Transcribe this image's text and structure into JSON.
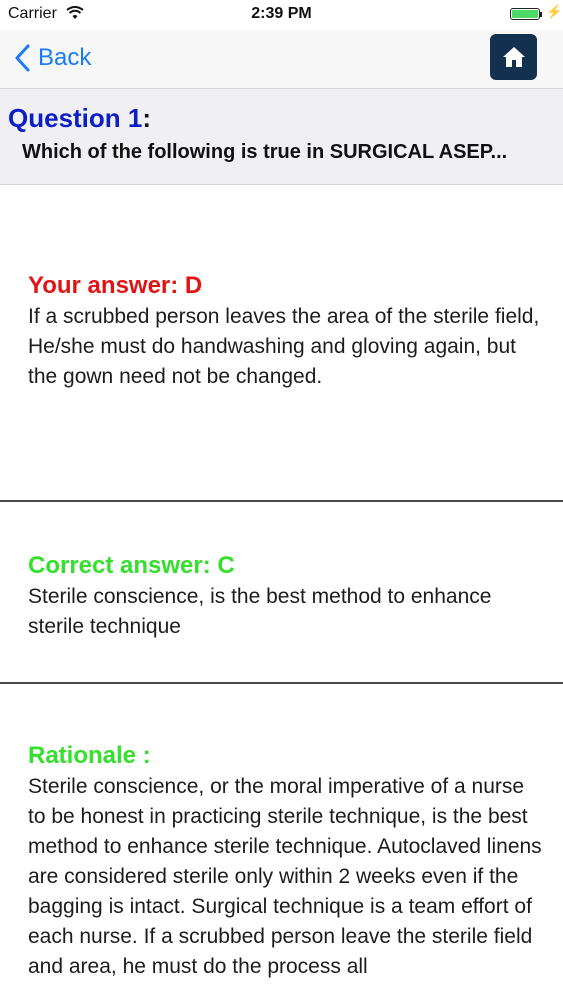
{
  "status_bar": {
    "carrier": "Carrier",
    "time": "2:39 PM"
  },
  "nav": {
    "back_label": "Back",
    "home_icon": "home-icon"
  },
  "question": {
    "label": "Question 1",
    "colon": ":",
    "text": "Which of the following is true in SURGICAL ASEP..."
  },
  "your_answer": {
    "title": "Your answer: D",
    "text": "  If a scrubbed person leaves the area of the sterile field, He/she must do handwashing and gloving again, but the gown need not be changed."
  },
  "correct_answer": {
    "title": "Correct answer: C",
    "text": " Sterile conscience, is the best method to enhance sterile technique"
  },
  "rationale": {
    "title": "Rationale :",
    "text": " Sterile conscience, or the moral imperative of a nurse to be honest in practicing sterile technique, is the best method to enhance sterile technique. Autoclaved linens are considered sterile only within 2 weeks even if the bagging is intact. Surgical technique is a team effort of each nurse. If a scrubbed person leave the sterile field and area, he must do the process all"
  },
  "colors": {
    "your_answer": "#e01414",
    "correct": "#33e02b",
    "question_label": "#0c1fc7",
    "home_button": "#14304f",
    "back": "#1a7cf5"
  }
}
